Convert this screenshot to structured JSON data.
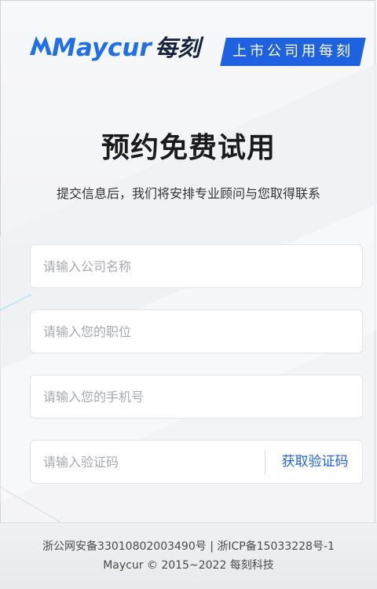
{
  "header": {
    "brand": "Maycur",
    "brand_cn": "每刻",
    "slogan": "上市公司用每刻",
    "colors": {
      "brand_blue": "#1f62e0",
      "dark": "#16233d"
    }
  },
  "main": {
    "title": "预约免费试用",
    "subtitle": "提交信息后，我们将安排专业顾问与您取得联系"
  },
  "form": {
    "company": {
      "placeholder": "请输入公司名称",
      "value": ""
    },
    "position": {
      "placeholder": "请输入您的职位",
      "value": ""
    },
    "phone": {
      "placeholder": "请输入您的手机号",
      "value": ""
    },
    "code": {
      "placeholder": "请输入验证码",
      "value": ""
    },
    "get_code_label": "获取验证码"
  },
  "footer": {
    "line1": "浙公网安备33010802003490号 | 浙ICP备15033228号-1",
    "line2": "Maycur © 2015~2022 每刻科技"
  }
}
